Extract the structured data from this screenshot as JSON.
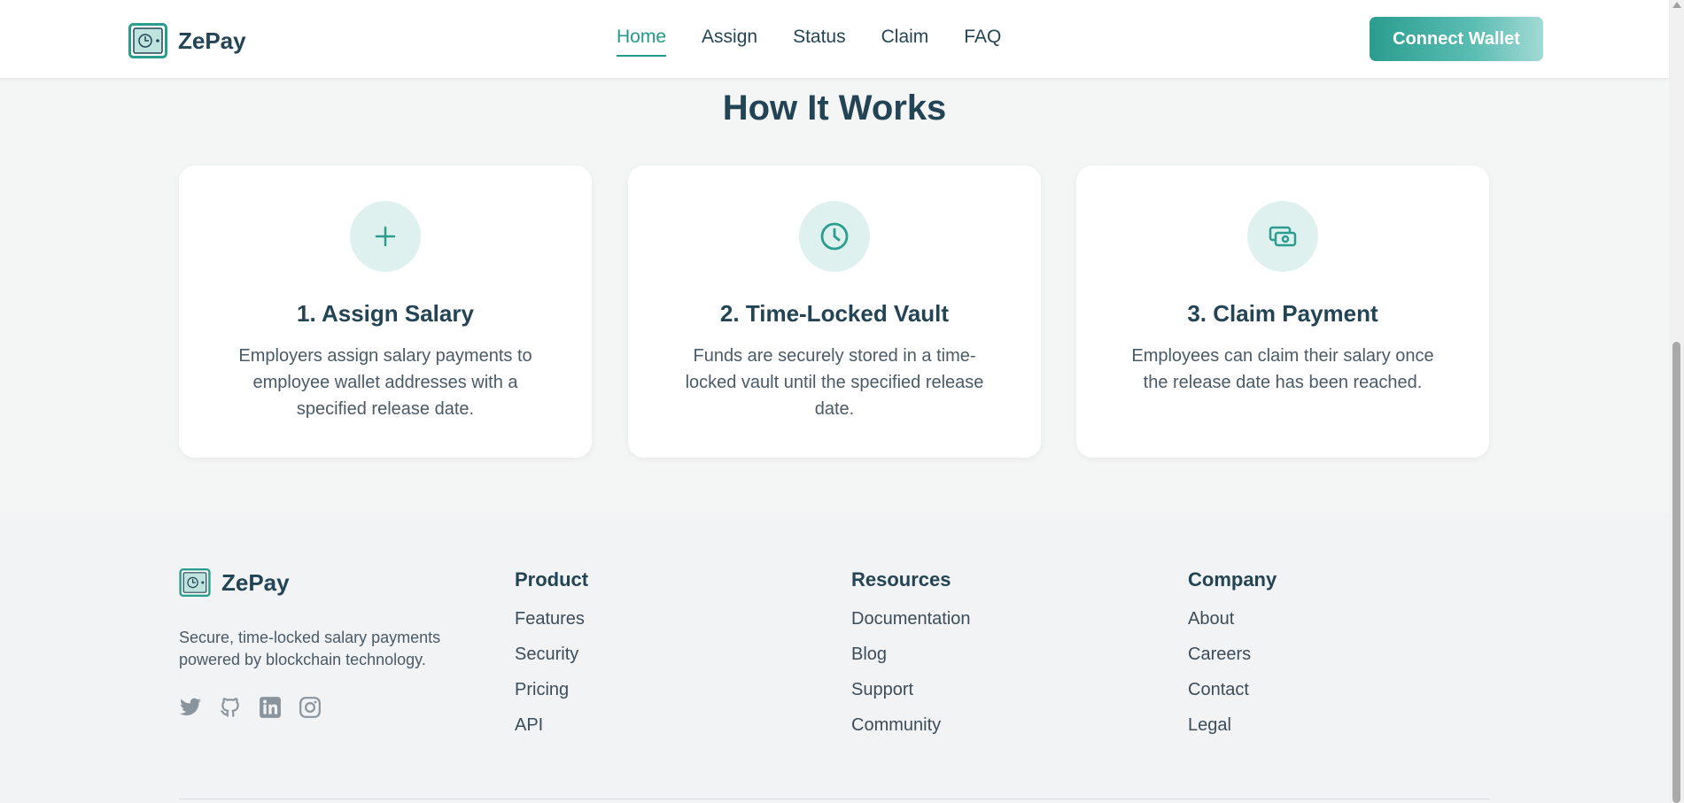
{
  "header": {
    "brand": "ZePay",
    "nav": [
      {
        "label": "Home",
        "active": true
      },
      {
        "label": "Assign",
        "active": false
      },
      {
        "label": "Status",
        "active": false
      },
      {
        "label": "Claim",
        "active": false
      },
      {
        "label": "FAQ",
        "active": false
      }
    ],
    "connect_label": "Connect Wallet"
  },
  "how_it_works": {
    "title": "How It Works",
    "cards": [
      {
        "icon": "plus-icon",
        "title": "1. Assign Salary",
        "desc": "Employers assign salary payments to employee wallet addresses with a specified release date."
      },
      {
        "icon": "clock-icon",
        "title": "2. Time-Locked Vault",
        "desc": "Funds are securely stored in a time-locked vault until the specified release date."
      },
      {
        "icon": "cash-icon",
        "title": "3. Claim Payment",
        "desc": "Employees can claim their salary once the release date has been reached."
      }
    ]
  },
  "footer": {
    "brand": "ZePay",
    "tagline": "Secure, time-locked salary payments powered by blockchain technology.",
    "socials": [
      "twitter-icon",
      "github-icon",
      "linkedin-icon",
      "instagram-icon"
    ],
    "columns": [
      {
        "title": "Product",
        "links": [
          "Features",
          "Security",
          "Pricing",
          "API"
        ]
      },
      {
        "title": "Resources",
        "links": [
          "Documentation",
          "Blog",
          "Support",
          "Community"
        ]
      },
      {
        "title": "Company",
        "links": [
          "About",
          "Careers",
          "Contact",
          "Legal"
        ]
      }
    ]
  },
  "colors": {
    "accent": "#2a9d8f",
    "text_dark": "#234454",
    "background": "#f4f5f5",
    "icon_circle": "#dff1ef"
  }
}
